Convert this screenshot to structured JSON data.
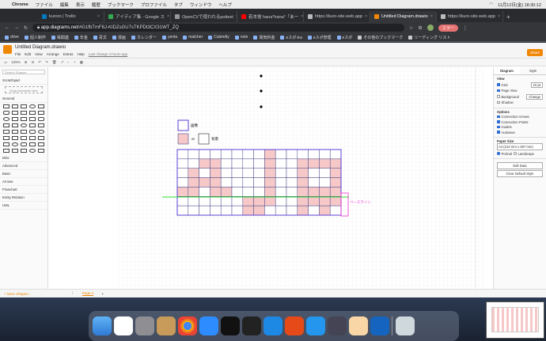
{
  "menubar": {
    "app": "Chrome",
    "items": [
      "ファイル",
      "編集",
      "表示",
      "履歴",
      "ブックマーク",
      "プロファイル",
      "タブ",
      "ウィンドウ",
      "ヘルプ"
    ],
    "datetime": "11月12日(金) 18:30:12"
  },
  "tabs": [
    {
      "title": "kuroro | Trello"
    },
    {
      "title": "アイディア集 - Google ス"
    },
    {
      "title": "OpenCVで使われるputtext"
    },
    {
      "title": "若本蛍 hana*hana*「あー"
    },
    {
      "title": "https://kuro-site.web.app"
    },
    {
      "title": "Untitled Diagram.drawio"
    },
    {
      "title": "https://kuro-site.web.app"
    }
  ],
  "address": {
    "url_host": "app.diagrams.net",
    "url_rest": "/#G1fbTmF8J-KIDZsGU7sTKPDt3CX31WT_ZQ",
    "error_label": "エラー"
  },
  "bookmarks": [
    "drive",
    "個人制作",
    "株関連",
    "年金",
    "青文",
    "漫画",
    "カレンダー",
    "yenta",
    "matcher",
    "Calendly",
    "note",
    "電気料金",
    "eスポ-tra",
    "eスポ管理",
    "eスポ",
    "その他のブックマーク",
    "リーディング リスト"
  ],
  "drawio": {
    "title": "Untitled Diagram.drawio",
    "menu": [
      "File",
      "Edit",
      "View",
      "Arrange",
      "Extras",
      "Help"
    ],
    "last_change": "Last change 4 hours ago",
    "share": "Share",
    "zoom": "125%",
    "search_placeholder": "Search Shapes",
    "scratchpad": "Scratchpad",
    "scratch_drop": "Drag elements here",
    "sections": [
      "General",
      "Misc",
      "Advanced",
      "Basic",
      "Arrows",
      "Flowchart",
      "Entity Relation",
      "UML"
    ],
    "more_shapes": "+ More Shapes...",
    "page_tab": "Page-1",
    "legend": {
      "img": "画像",
      "or": "or",
      "bg": "背景"
    },
    "baseline": "ベースライン",
    "panel": {
      "tab1": "Diagram",
      "tab2": "Style",
      "view": "View",
      "grid": "Grid",
      "grid_size": "10 pt",
      "page_view": "Page View",
      "background": "Background",
      "change": "Change",
      "shadow": "Shadow",
      "options": "Options",
      "opts": [
        "Connection Arrows",
        "Connection Points",
        "Guides",
        "Autosave"
      ],
      "paper_size": "Paper Size",
      "paper_value": "A4 (210 mm x 297 mm)",
      "portrait": "Portrait",
      "landscape": "Landscape",
      "edit_data": "Edit Data",
      "clear_style": "Clear Default Style"
    }
  },
  "grid_pattern": {
    "rows": 7,
    "cols": 15,
    "filled": [
      [
        0,
        8
      ],
      [
        1,
        2
      ],
      [
        1,
        3
      ],
      [
        1,
        8
      ],
      [
        1,
        11
      ],
      [
        1,
        12
      ],
      [
        1,
        13
      ],
      [
        1,
        14
      ],
      [
        2,
        1
      ],
      [
        2,
        3
      ],
      [
        2,
        8
      ],
      [
        2,
        11
      ],
      [
        2,
        14
      ],
      [
        3,
        1
      ],
      [
        3,
        2
      ],
      [
        3,
        3
      ],
      [
        3,
        8
      ],
      [
        3,
        11
      ],
      [
        3,
        14
      ],
      [
        4,
        0
      ],
      [
        4,
        1
      ],
      [
        4,
        3
      ],
      [
        4,
        4
      ],
      [
        4,
        8
      ],
      [
        4,
        11
      ],
      [
        4,
        12
      ],
      [
        4,
        13
      ],
      [
        4,
        14
      ],
      [
        5,
        6
      ],
      [
        5,
        7
      ],
      [
        5,
        8
      ],
      [
        5,
        11
      ],
      [
        5,
        12
      ],
      [
        5,
        13
      ],
      [
        5,
        14
      ],
      [
        6,
        6
      ],
      [
        6,
        7
      ],
      [
        6,
        11
      ],
      [
        6,
        13
      ]
    ]
  },
  "colors": {
    "accent": "#f08705",
    "cell_fill": "#f6c8c8",
    "cell_border": "#4a4a8a",
    "outer_border": "#5b3fd6",
    "baseline": "#33dd33",
    "baseline_label": "#ee33cc"
  }
}
